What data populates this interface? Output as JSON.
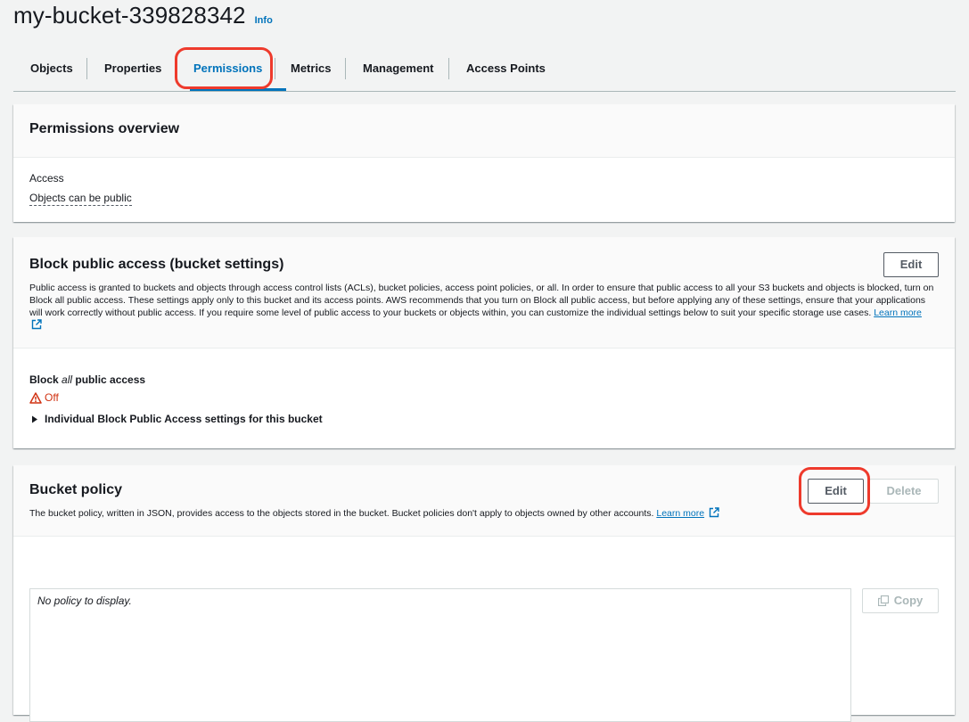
{
  "header": {
    "bucket_name": "my-bucket-339828342",
    "info_label": "Info"
  },
  "tabs": [
    {
      "label": "Objects"
    },
    {
      "label": "Properties"
    },
    {
      "label": "Permissions"
    },
    {
      "label": "Metrics"
    },
    {
      "label": "Management"
    },
    {
      "label": "Access Points"
    }
  ],
  "active_tab": "Permissions",
  "permissions_overview": {
    "title": "Permissions overview",
    "access_label": "Access",
    "access_value": "Objects can be public"
  },
  "block_public_access": {
    "title": "Block public access (bucket settings)",
    "edit_label": "Edit",
    "description": "Public access is granted to buckets and objects through access control lists (ACLs), bucket policies, access point policies, or all. In order to ensure that public access to all your S3 buckets and objects is blocked, turn on Block all public access. These settings apply only to this bucket and its access points. AWS recommends that you turn on Block all public access, but before applying any of these settings, ensure that your applications will work correctly without public access. If you require some level of public access to your buckets or objects within, you can customize the individual settings below to suit your specific storage use cases.",
    "learn_more": "Learn more",
    "setting_prefix": "Block ",
    "setting_emphasis": "all",
    "setting_suffix": " public access",
    "status": "Off",
    "individual_settings": "Individual Block Public Access settings for this bucket"
  },
  "bucket_policy": {
    "title": "Bucket policy",
    "description": "The bucket policy, written in JSON, provides access to the objects stored in the bucket. Bucket policies don't apply to objects owned by other accounts.",
    "learn_more": "Learn more",
    "edit_label": "Edit",
    "delete_label": "Delete",
    "empty_text": "No policy to display.",
    "copy_label": "Copy"
  },
  "colors": {
    "link": "#0073bb",
    "warning": "#d13212",
    "annotation": "#ee3a2c"
  }
}
